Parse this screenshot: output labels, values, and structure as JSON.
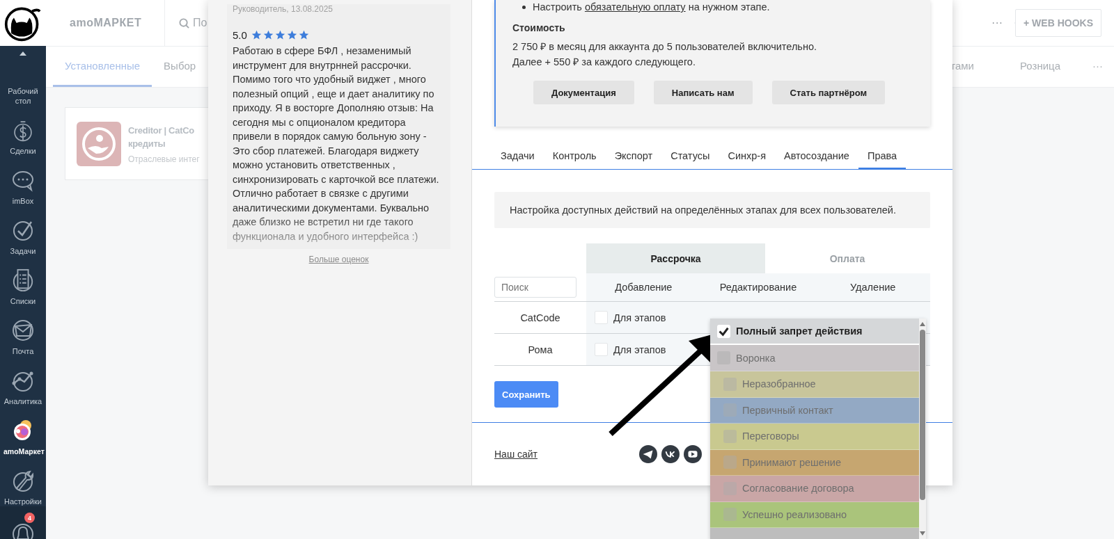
{
  "sidebar": {
    "items": [
      {
        "label": "Рабочий стол",
        "kind": "desk",
        "selected": false
      },
      {
        "label": "Сделки",
        "kind": "deals",
        "selected": false
      },
      {
        "label": "imBox",
        "kind": "chat",
        "selected": false
      },
      {
        "label": "Задачи",
        "kind": "tasks",
        "selected": false
      },
      {
        "label": "Списки",
        "kind": "lists",
        "selected": false
      },
      {
        "label": "Почта",
        "kind": "mail",
        "selected": false
      },
      {
        "label": "Аналитика",
        "kind": "analytics",
        "selected": false
      },
      {
        "label": "amoМаркет",
        "kind": "market",
        "selected": true
      },
      {
        "label": "Настройки",
        "kind": "settings",
        "selected": false
      }
    ],
    "notifications": {
      "badge": "4"
    }
  },
  "header": {
    "title": "amoМАРКЕТ",
    "search": {
      "placeholder": "По"
    },
    "more": "···",
    "webhooks_button": "+ WEB HOOKS"
  },
  "tabs": [
    {
      "label": "Установленные",
      "selected": true
    },
    {
      "label": "Выбор",
      "selected": false
    }
  ],
  "tabs_right": [
    {
      "label": "тами",
      "selected": false
    },
    {
      "label": "Розница",
      "selected": false
    }
  ],
  "tabs_more": "···",
  "card": {
    "title": "Creditor | CatCo",
    "subtitle": "кредиты",
    "category": "Отраслевые интег"
  },
  "modal": {
    "review": {
      "author": "Руководитель, 13.08.2025",
      "rating": "5.0",
      "stars": 5,
      "text": "Работаю в сфере БФЛ , незаменимый инструмент для внутрнней рассрочки. Помимо того что удобный виджет , много полезный опций , еще и дает аналитику по приходу. Я в восторге Дополняю отзыв: На сегодня мы с опционалом кредитора привели в порядок самую больную зону - Это сбор платежей. Благодаря виджету можно установить ответственных , синхронизировать с карточкой все платежи. Отлично работает в связке с другими аналитическими документами. Буквально даже близко не встретил ни где такого функционала и удобного интерфейса :)",
      "more_link": "Больше оценок"
    },
    "info": {
      "bullet_before": "Настроить ",
      "bullet_link": "обязательную оплату",
      "bullet_after": " на нужном этапе.",
      "cost_title": "Стоимость",
      "price_lines": [
        "2 750 ₽ в месяц для аккаунта до 5 пользователей включительно.",
        "Далее + 550 ₽ за каждого следующего."
      ],
      "buttons": [
        "Документация",
        "Написать нам",
        "Стать партнёром"
      ]
    },
    "tabs": [
      {
        "label": "Задачи",
        "selected": false
      },
      {
        "label": "Контроль",
        "selected": false
      },
      {
        "label": "Экспорт",
        "selected": false
      },
      {
        "label": "Статусы",
        "selected": false
      },
      {
        "label": "Синхр-я",
        "selected": false
      },
      {
        "label": "Автосоздание",
        "selected": false
      },
      {
        "label": "Права",
        "selected": true
      }
    ],
    "note": "Настройка доступных действий на определённых этапах для всех пользователей.",
    "permissions": {
      "groups": [
        {
          "label": "Рассрочка",
          "selected": true
        },
        {
          "label": "Оплата",
          "selected": false
        }
      ],
      "search": {
        "placeholder": "Поиск"
      },
      "columns": [
        "Добавление",
        "Редактирование",
        "Удаление"
      ],
      "rows": [
        {
          "name": "CatCode",
          "option": {
            "label": "Для этапов",
            "checked": false
          }
        },
        {
          "name": "Рома",
          "option": {
            "label": "Для этапов",
            "checked": false
          }
        }
      ]
    },
    "save_button": "Сохранить",
    "footer": {
      "site_link": "Наш сайт"
    },
    "dropdown": {
      "items": [
        {
          "label": "Полный запрет действия",
          "checked": true,
          "color": "#d5d7d9"
        },
        {
          "label": "Воронка",
          "checked": false,
          "color": "#c9c5c7",
          "children": [
            {
              "label": "Неразобранное",
              "checked": false,
              "color": "#c8c59b"
            },
            {
              "label": "Первичный контакт",
              "checked": false,
              "color": "#93a9c4"
            },
            {
              "label": "Переговоры",
              "checked": false,
              "color": "#c9c98f"
            },
            {
              "label": "Принимают решение",
              "checked": false,
              "color": "#c6a670"
            },
            {
              "label": "Согласование договора",
              "checked": false,
              "color": "#c9a6a6"
            },
            {
              "label": "Успешно реализовано",
              "checked": false,
              "color": "#aac47b"
            }
          ]
        }
      ]
    }
  }
}
